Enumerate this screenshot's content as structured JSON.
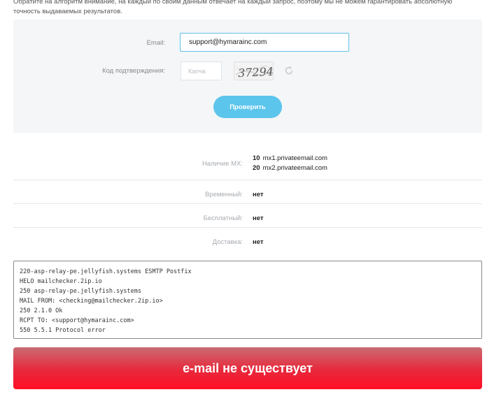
{
  "intro": {
    "text": "Обратите на алгоритм внимание, на каждый по своим данным отвечает на каждый запрос, поэтому мы не можем гарантировать абсолютную точность выдаваемых результатов."
  },
  "form": {
    "email_label": "Email:",
    "email_value": "support@hymarainc.com",
    "code_label": "Код подтверждения:",
    "captcha_placeholder": "Капча",
    "captcha_text": "37294",
    "submit_label": "Проверить"
  },
  "results": {
    "mx_label": "Наличие MX:",
    "mx": [
      {
        "priority": "10",
        "host": "mx1.privateemail.com"
      },
      {
        "priority": "20",
        "host": "mx2.privateemail.com"
      }
    ],
    "temporary_label": "Временный:",
    "temporary_value": "нет",
    "free_label": "Бесплатный:",
    "free_value": "нет",
    "delivery_label": "Доставка:",
    "delivery_value": "нет"
  },
  "log": [
    "220-asp-relay-pe.jellyfish.systems ESMTP Postfix",
    "HELO mailchecker.2ip.io",
    "250 asp-relay-pe.jellyfish.systems",
    "MAIL FROM: <checking@mailchecker.2ip.io>",
    "250 2.1.0 Ok",
    "RCPT TO: <support@hymarainc.com>",
    "550 5.5.1 Protocol error"
  ],
  "verdict": "e-mail не существует",
  "colors": {
    "accent": "#5cc5ec",
    "panel_bg": "#f4f6f8",
    "error": "#ff0f26"
  }
}
